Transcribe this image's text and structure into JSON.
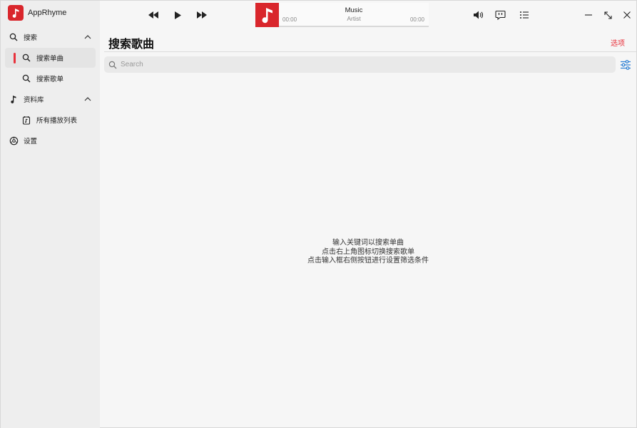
{
  "app": {
    "title": "AppRhyme",
    "accent": "#e8323c",
    "logo_color": "#d9262c"
  },
  "sidebar": {
    "groups": [
      {
        "label": "搜索",
        "icon": "search-icon",
        "items": [
          {
            "label": "搜索单曲",
            "icon": "search-icon",
            "active": true
          },
          {
            "label": "搜索歌单",
            "icon": "search-icon",
            "active": false
          }
        ]
      },
      {
        "label": "资料库",
        "icon": "music-note-icon",
        "items": [
          {
            "label": "所有播放列表",
            "icon": "playlist-icon",
            "active": false
          }
        ]
      }
    ],
    "settings": {
      "label": "设置",
      "icon": "gear-icon"
    }
  },
  "player": {
    "title": "Music",
    "artist": "Artist",
    "current_time": "00:00",
    "total_time": "00:00"
  },
  "main": {
    "title": "搜索歌曲",
    "options_label": "选项",
    "search": {
      "placeholder": "Search",
      "value": ""
    },
    "hints": [
      "输入关键词以搜索单曲",
      "点击右上角图标切换搜索歌单",
      "点击输入框右侧按钮进行设置筛选条件"
    ]
  }
}
